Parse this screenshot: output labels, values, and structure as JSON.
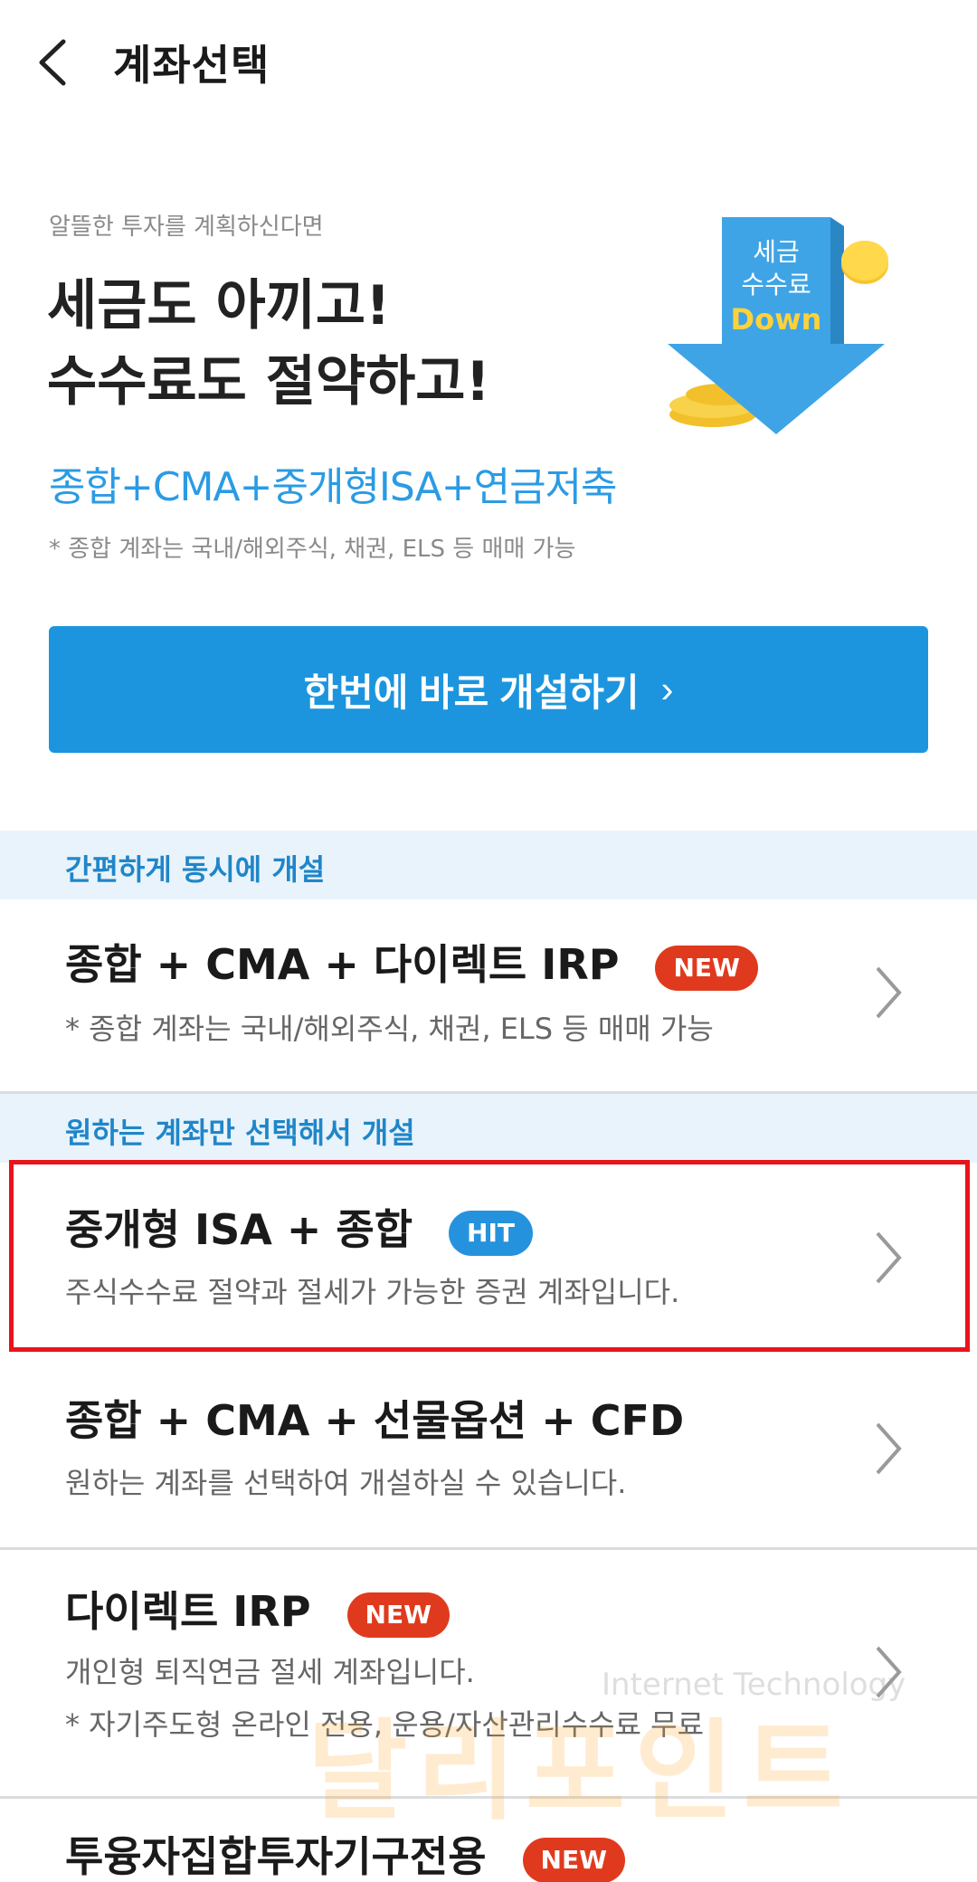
{
  "header": {
    "title": "계좌선택",
    "back_icon": "chevron-left-icon"
  },
  "promo": {
    "subtitle": "알뜰한 투자를 계획하신다면",
    "headline_line1": "세금도 아끼고!",
    "headline_line2": "수수료도 절약하고!",
    "products": "종합+CMA+중개형ISA+연금저축",
    "note": "* 종합 계좌는 국내/해외주식, 채권, ELS 등 매매 가능",
    "art_line1": "세금",
    "art_line2": "수수료",
    "art_line3": "Down"
  },
  "open_button": {
    "label": "한번에 바로 개설하기",
    "chevron": "›"
  },
  "sections": [
    {
      "label": "간편하게 동시에 개설",
      "rows": [
        {
          "title": "종합 + CMA + 다이렉트 IRP",
          "badge": "NEW",
          "desc": "* 종합 계좌는 국내/해외주식, 채권, ELS 등 매매 가능"
        }
      ]
    },
    {
      "label": "원하는 계좌만 선택해서 개설",
      "rows": [
        {
          "title": "중개형 ISA + 종합",
          "badge": "HIT",
          "desc": "주식수수료 절약과 절세가 가능한 증권 계좌입니다."
        },
        {
          "title": "종합 + CMA + 선물옵션 + CFD",
          "badge": "",
          "desc": "원하는 계좌를 선택하여 개설하실 수 있습니다."
        },
        {
          "title": "다이렉트 IRP",
          "badge": "NEW",
          "desc": "개인형 퇴직연금 절세 계좌입니다.",
          "desc2": "* 자기주도형 온라인 전용, 운용/자산관리수수료 무료"
        },
        {
          "title": "투융자집합투자기구전용",
          "badge": "NEW"
        }
      ]
    }
  ],
  "watermark": {
    "text": "달리포인트",
    "sub": "Internet Technology"
  },
  "colors": {
    "primary": "#1c95de",
    "section_bg": "#e9f3fb",
    "section_text": "#1f86c9",
    "badge_new": "#e03a1e",
    "badge_hit": "#2592de",
    "highlight": "#e8141b"
  }
}
